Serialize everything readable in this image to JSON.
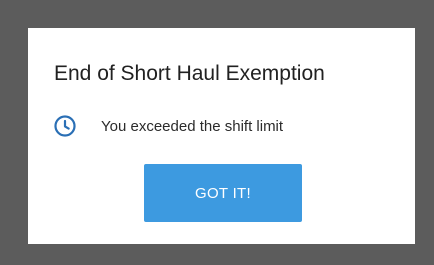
{
  "dialog": {
    "title": "End of Short Haul Exemption",
    "message": "You exceeded the shift limit",
    "icon": "clock-icon",
    "button_label": "GOT IT!"
  },
  "colors": {
    "overlay": "#5c5c5c",
    "dialog_background": "#ffffff",
    "accent": "#3d9ae0",
    "icon": "#2a6fb5",
    "text": "#212121"
  }
}
